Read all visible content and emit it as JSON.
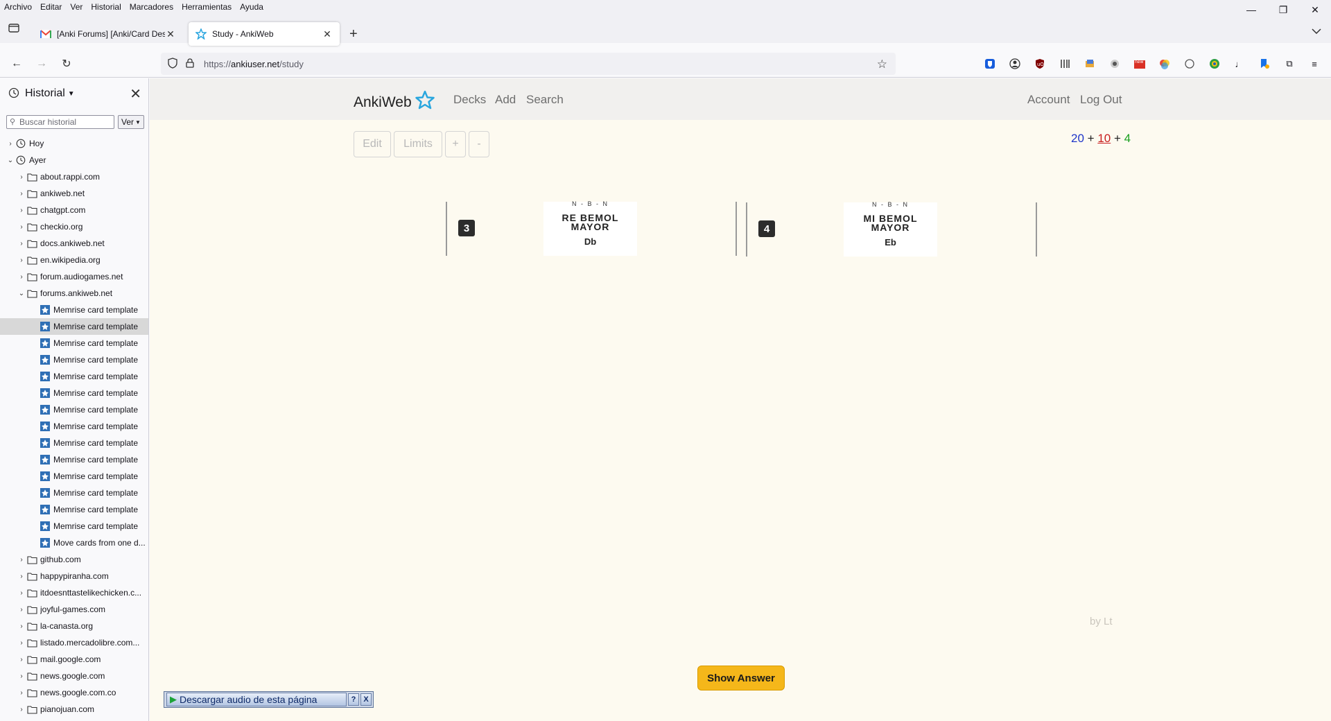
{
  "menu": [
    "Archivo",
    "Editar",
    "Ver",
    "Historial",
    "Marcadores",
    "Herramientas",
    "Ayuda"
  ],
  "tabs": [
    {
      "title": "[Anki Forums] [Anki/Card Design]",
      "favicon": "gmail-icon"
    },
    {
      "title": "Study - AnkiWeb",
      "favicon": "ankiweb-star-icon"
    }
  ],
  "urlbar": {
    "prefix": "https://",
    "domain": "ankiuser.net",
    "path": "/study"
  },
  "sidebar": {
    "title": "Historial",
    "search_placeholder": "Buscar historial",
    "view_label": "Ver",
    "groups": [
      {
        "label": "Hoy",
        "expanded": false
      },
      {
        "label": "Ayer",
        "expanded": true
      }
    ],
    "sites_before": [
      "about.rappi.com",
      "ankiweb.net",
      "chatgpt.com",
      "checkio.org",
      "docs.ankiweb.net",
      "en.wikipedia.org",
      "forum.audiogames.net"
    ],
    "open_site": "forums.ankiweb.net",
    "pages": [
      "Memrise card template",
      "Memrise card template",
      "Memrise card template",
      "Memrise card template",
      "Memrise card template",
      "Memrise card template",
      "Memrise card template",
      "Memrise card template",
      "Memrise card template",
      "Memrise card template",
      "Memrise card template",
      "Memrise card template",
      "Memrise card template",
      "Memrise card template",
      "Move cards from one d..."
    ],
    "sites_after": [
      "github.com",
      "happypiranha.com",
      "itdoesnttastelikechicken.c...",
      "joyful-games.com",
      "la-canasta.org",
      "listado.mercadolibre.com...",
      "mail.google.com",
      "news.google.com",
      "news.google.com.co",
      "pianojuan.com"
    ]
  },
  "ankiweb": {
    "brand": "AnkiWeb",
    "nav": {
      "decks": "Decks",
      "add": "Add",
      "search": "Search",
      "account": "Account",
      "logout": "Log Out"
    },
    "buttons": {
      "edit": "Edit",
      "limits": "Limits",
      "plus": "+",
      "minus": "-"
    },
    "counts": {
      "new": "20",
      "learning": "10",
      "review": "4",
      "sep": "+"
    },
    "cards": [
      {
        "number": "3",
        "meta": "N - B - N",
        "name_line1": "RE BEMOL",
        "name_line2": "MAYOR",
        "abbr": "Db"
      },
      {
        "number": "4",
        "meta": "N - B - N",
        "name_line1": "MI BEMOL",
        "name_line2": "MAYOR",
        "abbr": "Eb"
      }
    ],
    "byline": "by Lt",
    "show_answer": "Show Answer"
  },
  "audio_bar": {
    "label": "Descargar audio de esta página",
    "help": "?",
    "close": "X"
  },
  "colors": {
    "accent": "#f5b71a",
    "new": "#1f35c9",
    "learning": "#c81e1e",
    "review": "#19a01e"
  }
}
